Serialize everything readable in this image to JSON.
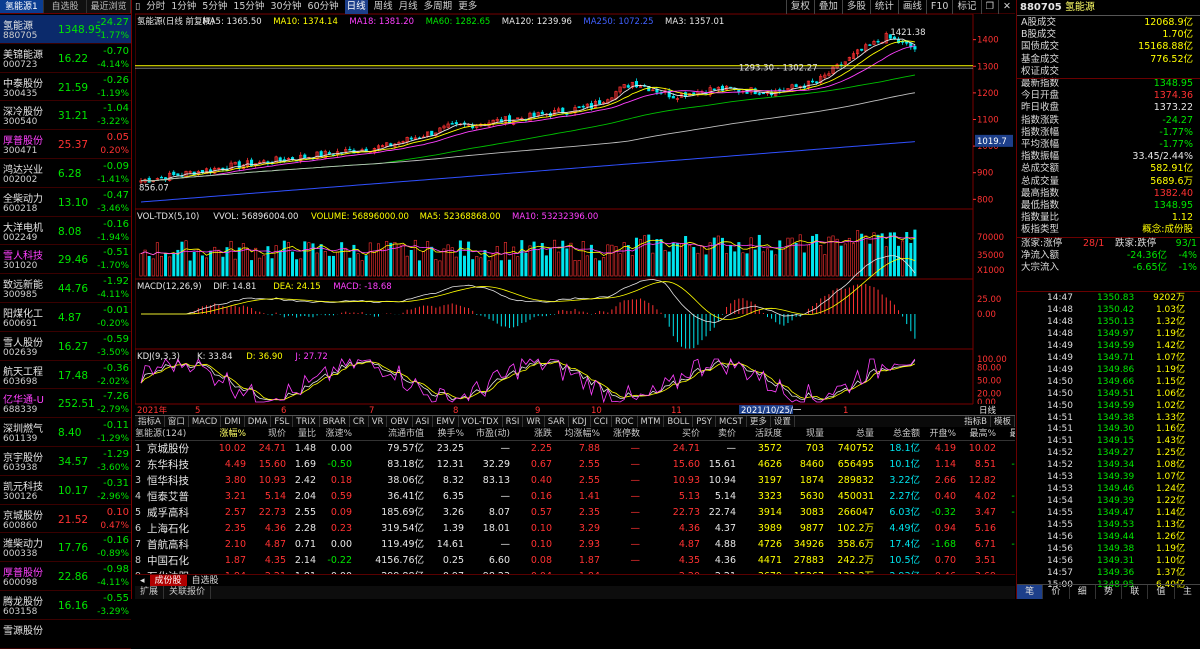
{
  "left_tabs": [
    "氢能源1",
    "自选股",
    "最近浏览"
  ],
  "watchlist": [
    {
      "name": "氢能源",
      "code": "880705",
      "price": "1348.95",
      "change": "-24.27",
      "pct": "-1.77%",
      "dir": "g",
      "sel": true
    },
    {
      "name": "美锦能源",
      "code": "000723",
      "price": "16.22",
      "change": "-0.70",
      "pct": "-4.14%",
      "dir": "g"
    },
    {
      "name": "中泰股份",
      "code": "300435",
      "price": "21.59",
      "change": "-0.26",
      "pct": "-1.19%",
      "dir": "g"
    },
    {
      "name": "深冷股份",
      "code": "300540",
      "price": "31.21",
      "change": "-1.04",
      "pct": "-3.22%",
      "dir": "g"
    },
    {
      "name": "厚普股份",
      "code": "300471",
      "price": "25.37",
      "change": "0.05",
      "pct": "0.20%",
      "dir": "r",
      "namecolor": "m"
    },
    {
      "name": "鸿达兴业",
      "code": "002002",
      "price": "6.28",
      "change": "-0.09",
      "pct": "-1.41%",
      "dir": "g"
    },
    {
      "name": "全柴动力",
      "code": "600218",
      "price": "13.10",
      "change": "-0.47",
      "pct": "-3.46%",
      "dir": "g"
    },
    {
      "name": "大洋电机",
      "code": "002249",
      "price": "8.08",
      "change": "-0.16",
      "pct": "-1.94%",
      "dir": "g"
    },
    {
      "name": "雪人科技",
      "code": "301020",
      "price": "29.46",
      "change": "-0.51",
      "pct": "-1.70%",
      "dir": "g",
      "namecolor": "m"
    },
    {
      "name": "致远新能",
      "code": "300985",
      "price": "44.76",
      "change": "-1.92",
      "pct": "-4.11%",
      "dir": "g"
    },
    {
      "name": "阳煤化工",
      "code": "600691",
      "price": "4.87",
      "change": "-0.01",
      "pct": "-0.20%",
      "dir": "g"
    },
    {
      "name": "雪人股份",
      "code": "002639",
      "price": "16.27",
      "change": "-0.59",
      "pct": "-3.50%",
      "dir": "g"
    },
    {
      "name": "航天工程",
      "code": "603698",
      "price": "17.48",
      "change": "-0.36",
      "pct": "-2.02%",
      "dir": "g"
    },
    {
      "name": "亿华通-U",
      "code": "688339",
      "price": "252.51",
      "change": "-7.26",
      "pct": "-2.79%",
      "dir": "g",
      "namecolor": "m"
    },
    {
      "name": "深圳燃气",
      "code": "601139",
      "price": "8.40",
      "change": "-0.11",
      "pct": "-1.29%",
      "dir": "g"
    },
    {
      "name": "京宇股份",
      "code": "603938",
      "price": "34.57",
      "change": "-1.29",
      "pct": "-3.60%",
      "dir": "g"
    },
    {
      "name": "凯元科技",
      "code": "300126",
      "price": "10.17",
      "change": "-0.31",
      "pct": "-2.96%",
      "dir": "g"
    },
    {
      "name": "京城股份",
      "code": "600860",
      "price": "21.52",
      "change": "0.10",
      "pct": "0.47%",
      "dir": "r"
    },
    {
      "name": "潍柴动力",
      "code": "000338",
      "price": "17.76",
      "change": "-0.16",
      "pct": "-0.89%",
      "dir": "g"
    },
    {
      "name": "厚普股份",
      "code": "600098",
      "price": "22.86",
      "change": "-0.98",
      "pct": "-4.11%",
      "dir": "g",
      "namecolor": "m"
    },
    {
      "name": "腾龙股份",
      "code": "603158",
      "price": "16.16",
      "change": "-0.55",
      "pct": "-3.29%",
      "dir": "g"
    },
    {
      "name": "雪源股份",
      "code": "",
      "price": "",
      "change": "",
      "pct": "",
      "dir": "g"
    }
  ],
  "toolbar": {
    "periods": [
      "分时",
      "1分钟",
      "5分钟",
      "15分钟",
      "30分钟",
      "60分钟",
      "日线",
      "周线",
      "月线",
      "多周期",
      "更多"
    ],
    "active": "日线",
    "right": [
      "复权",
      "叠加",
      "多股",
      "统计",
      "画线",
      "F10",
      "标记"
    ]
  },
  "chart_data": [
    {
      "type": "candlestick",
      "name": "main",
      "legend": [
        {
          "t": "氢能源(日线 前复权)",
          "c": "w"
        },
        {
          "t": "MA5: 1365.50",
          "c": "w"
        },
        {
          "t": "MA10: 1374.14",
          "c": "y"
        },
        {
          "t": "MA18: 1381.20",
          "c": "m"
        },
        {
          "t": "MA60: 1282.65",
          "c": "g"
        },
        {
          "t": "MA120: 1239.96",
          "c": "w"
        },
        {
          "t": "MA250: 1072.25",
          "c": "b"
        },
        {
          "t": "MA3: 1357.01",
          "c": "w"
        }
      ],
      "y_ticks": [
        "1400",
        "1300",
        "1200",
        "1100",
        "1000",
        "900",
        "800"
      ],
      "current_label": "1019.7",
      "annotations": {
        "high": "1421.38",
        "range": "1293.30 - 1302.27",
        "low": "856.07"
      }
    },
    {
      "type": "bar",
      "name": "volume",
      "legend": [
        {
          "t": "VOL-TDX(5,10)",
          "c": "w"
        },
        {
          "t": "VVOL: 56896004.00",
          "c": "w"
        },
        {
          "t": "VOLUME: 56896000.00",
          "c": "y"
        },
        {
          "t": "MA5: 52368868.00",
          "c": "y"
        },
        {
          "t": "MA10: 53232396.00",
          "c": "m"
        }
      ],
      "y_ticks": [
        "70000",
        "35000"
      ],
      "unit": "X1000"
    },
    {
      "type": "line",
      "name": "macd",
      "legend": [
        {
          "t": "MACD(12,26,9)",
          "c": "w"
        },
        {
          "t": "DIF: 14.81",
          "c": "w"
        },
        {
          "t": "DEA: 24.15",
          "c": "y"
        },
        {
          "t": "MACD: -18.68",
          "c": "m"
        }
      ],
      "y_ticks": [
        "25.00",
        "0.00"
      ]
    },
    {
      "type": "line",
      "name": "kdj",
      "legend": [
        {
          "t": "KDJ(9,3,3)",
          "c": "w"
        },
        {
          "t": "K: 33.84",
          "c": "w"
        },
        {
          "t": "D: 36.90",
          "c": "y"
        },
        {
          "t": "J: 27.72",
          "c": "m"
        }
      ],
      "y_ticks": [
        "100.00",
        "80.00",
        "50.00",
        "20.00",
        "0.00"
      ]
    }
  ],
  "date_axis": {
    "labels": [
      "2021年",
      "5",
      "6",
      "7",
      "8",
      "9",
      "10",
      "11",
      "12",
      "1"
    ],
    "highlight": "2021/10/25/一",
    "right_btn": "日线"
  },
  "indicator_tabs": [
    "指标A",
    "窗口",
    "MACD",
    "DMI",
    "DMA",
    "FSL",
    "TRIX",
    "BRAR",
    "CR",
    "VR",
    "OBV",
    "ASI",
    "EMV",
    "VOL-TDX",
    "RSI",
    "WR",
    "SAR",
    "KDJ",
    "CCI",
    "ROC",
    "MTM",
    "BOLL",
    "PSY",
    "MCST",
    "更多",
    "设置"
  ],
  "indicator_right": [
    "指标B",
    "模板"
  ],
  "table": {
    "headers": [
      "氢能源(124)",
      "涨幅%",
      "现价",
      "量比",
      "涨速%",
      "流通市值",
      "换手%",
      "市盈(动)",
      "涨跌",
      "均涨幅%",
      "涨停数",
      "买价",
      "卖价",
      "活跃度",
      "现量",
      "总量",
      "总金额",
      "开盘%",
      "最高%",
      "最低%"
    ],
    "rows": [
      [
        "1",
        "京城股份",
        "10.02",
        "24.71",
        "1.48",
        "0.00",
        "79.57亿",
        "23.25",
        "—",
        "2.25",
        "7.88",
        "—",
        "24.71",
        "—",
        "3572",
        "703",
        "740752",
        "18.1亿",
        "4.19",
        "10.02",
        "2.40"
      ],
      [
        "2",
        "东华科技",
        "4.49",
        "15.60",
        "1.69",
        "-0.50",
        "83.18亿",
        "12.31",
        "32.29",
        "0.67",
        "2.55",
        "—",
        "15.60",
        "15.61",
        "4626",
        "8460",
        "656495",
        "10.1亿",
        "1.14",
        "8.51",
        "-2.21"
      ],
      [
        "3",
        "恒华科技",
        "3.80",
        "10.93",
        "2.42",
        "0.18",
        "38.06亿",
        "8.32",
        "83.13",
        "0.40",
        "2.55",
        "—",
        "10.93",
        "10.94",
        "3197",
        "1874",
        "289832",
        "3.22亿",
        "2.66",
        "12.82",
        "2.56"
      ],
      [
        "4",
        "恒泰艾普",
        "3.21",
        "5.14",
        "2.04",
        "0.59",
        "36.41亿",
        "6.35",
        "—",
        "0.16",
        "1.41",
        "—",
        "5.13",
        "5.14",
        "3323",
        "5630",
        "450031",
        "2.27亿",
        "0.40",
        "4.02",
        "-2.81"
      ],
      [
        "5",
        "威孚高科",
        "2.57",
        "22.73",
        "2.55",
        "0.09",
        "185.69亿",
        "3.26",
        "8.07",
        "0.57",
        "2.35",
        "—",
        "22.73",
        "22.74",
        "3914",
        "3083",
        "266047",
        "6.03亿",
        "-0.32",
        "3.47",
        "-0.50"
      ],
      [
        "6",
        "上海石化",
        "2.35",
        "4.36",
        "2.28",
        "0.23",
        "319.54亿",
        "1.39",
        "18.01",
        "0.10",
        "3.29",
        "—",
        "4.36",
        "4.37",
        "3989",
        "9877",
        "102.2万",
        "4.49亿",
        "0.94",
        "5.16",
        "0.23"
      ],
      [
        "7",
        "首航高科",
        "2.10",
        "4.87",
        "0.71",
        "0.00",
        "119.49亿",
        "14.61",
        "—",
        "0.10",
        "2.93",
        "—",
        "4.87",
        "4.88",
        "4726",
        "34926",
        "358.6万",
        "17.4亿",
        "-1.68",
        "6.71",
        "-5.03"
      ],
      [
        "8",
        "中国石化",
        "1.87",
        "4.35",
        "2.14",
        "-0.22",
        "4156.76亿",
        "0.25",
        "6.60",
        "0.08",
        "1.87",
        "—",
        "4.35",
        "4.36",
        "4471",
        "27883",
        "242.2万",
        "10.5亿",
        "0.70",
        "3.51",
        "0.23"
      ],
      [
        "9",
        "石化油服",
        "1.84",
        "2.21",
        "1.81",
        "0.00",
        "299.88亿",
        "0.97",
        "98.23",
        "0.04",
        "1.84",
        "—",
        "2.20",
        "2.21",
        "3679",
        "15267",
        "132.2万",
        "2.93亿",
        "0.46",
        "3.69",
        "0.23"
      ]
    ]
  },
  "bottom_tabs": [
    "成份股",
    "自选股"
  ],
  "status": [
    "扩展",
    "关联报价"
  ],
  "right_panel": {
    "title_code": "880705",
    "title_name": "氢能源",
    "quote": [
      {
        "k": "A股成交",
        "v": "12068.9亿",
        "c": "y"
      },
      {
        "k": "B股成交",
        "v": "1.70亿",
        "c": "y"
      },
      {
        "k": "国债成交",
        "v": "15168.88亿",
        "c": "y"
      },
      {
        "k": "基金成交",
        "v": "776.52亿",
        "c": "y"
      },
      {
        "k": "权证成交",
        "v": "",
        "c": "y"
      },
      {
        "k": "最新指数",
        "v": "1348.95",
        "c": "g"
      },
      {
        "k": "今日开盘",
        "v": "1374.36",
        "c": "r"
      },
      {
        "k": "昨日收盘",
        "v": "1373.22",
        "c": "w"
      },
      {
        "k": "指数涨跌",
        "v": "-24.27",
        "c": "g"
      },
      {
        "k": "指数涨幅",
        "v": "-1.77%",
        "c": "g"
      },
      {
        "k": "平均涨幅",
        "v": "-1.77%",
        "c": "g"
      },
      {
        "k": "指数振幅",
        "v": "33.45/2.44%",
        "c": "w"
      },
      {
        "k": "总成交额",
        "v": "582.91亿",
        "c": "y"
      },
      {
        "k": "总成交量",
        "v": "5689.6万",
        "c": "y"
      },
      {
        "k": "最高指数",
        "v": "1382.40",
        "c": "r"
      },
      {
        "k": "最低指数",
        "v": "1348.95",
        "c": "g"
      },
      {
        "k": "指数量比",
        "v": "1.12",
        "c": "y"
      },
      {
        "k": "板指类型",
        "v": "概念:成份股",
        "c": "y"
      }
    ],
    "up_down": {
      "k1": "涨家:涨停",
      "v1": "28/1",
      "k2": "跌家:跌停",
      "v2": "93/1"
    },
    "flows": [
      {
        "k": "净流入额",
        "v": "-24.36亿",
        "p": "-4%"
      },
      {
        "k": "大宗流入",
        "v": "-6.65亿",
        "p": "-1%"
      }
    ],
    "ticks": [
      {
        "t": "14:47",
        "p": "1350.83",
        "a": "9202万",
        "pc": "g"
      },
      {
        "t": "14:48",
        "p": "1350.42",
        "a": "1.03亿",
        "pc": "g"
      },
      {
        "t": "14:48",
        "p": "1350.13",
        "a": "1.32亿",
        "pc": "g"
      },
      {
        "t": "14:48",
        "p": "1349.97",
        "a": "1.19亿",
        "pc": "g"
      },
      {
        "t": "14:49",
        "p": "1349.59",
        "a": "1.42亿",
        "pc": "g"
      },
      {
        "t": "14:49",
        "p": "1349.71",
        "a": "1.07亿",
        "pc": "g"
      },
      {
        "t": "14:49",
        "p": "1349.86",
        "a": "1.19亿",
        "pc": "g"
      },
      {
        "t": "14:50",
        "p": "1349.66",
        "a": "1.15亿",
        "pc": "g"
      },
      {
        "t": "14:50",
        "p": "1349.51",
        "a": "1.06亿",
        "pc": "g"
      },
      {
        "t": "14:50",
        "p": "1349.59",
        "a": "1.02亿",
        "pc": "g"
      },
      {
        "t": "14:51",
        "p": "1349.38",
        "a": "1.33亿",
        "pc": "g"
      },
      {
        "t": "14:51",
        "p": "1349.30",
        "a": "1.16亿",
        "pc": "g"
      },
      {
        "t": "14:51",
        "p": "1349.15",
        "a": "1.43亿",
        "pc": "g"
      },
      {
        "t": "14:52",
        "p": "1349.27",
        "a": "1.25亿",
        "pc": "g"
      },
      {
        "t": "14:52",
        "p": "1349.34",
        "a": "1.08亿",
        "pc": "g"
      },
      {
        "t": "14:53",
        "p": "1349.39",
        "a": "1.07亿",
        "pc": "g"
      },
      {
        "t": "14:53",
        "p": "1349.46",
        "a": "1.24亿",
        "pc": "g"
      },
      {
        "t": "14:54",
        "p": "1349.39",
        "a": "1.22亿",
        "pc": "g"
      },
      {
        "t": "14:55",
        "p": "1349.47",
        "a": "1.14亿",
        "pc": "g"
      },
      {
        "t": "14:55",
        "p": "1349.53",
        "a": "1.13亿",
        "pc": "g"
      },
      {
        "t": "14:56",
        "p": "1349.44",
        "a": "1.26亿",
        "pc": "g"
      },
      {
        "t": "14:56",
        "p": "1349.38",
        "a": "1.19亿",
        "pc": "g"
      },
      {
        "t": "14:56",
        "p": "1349.31",
        "a": "1.10亿",
        "pc": "g"
      },
      {
        "t": "14:57",
        "p": "1349.36",
        "a": "1.37亿",
        "pc": "g"
      },
      {
        "t": "15:00",
        "p": "1348.95",
        "a": "6.40亿",
        "pc": "g"
      }
    ],
    "bottom_tabs": [
      "笔",
      "价",
      "细",
      "势",
      "联",
      "值",
      "主"
    ]
  }
}
